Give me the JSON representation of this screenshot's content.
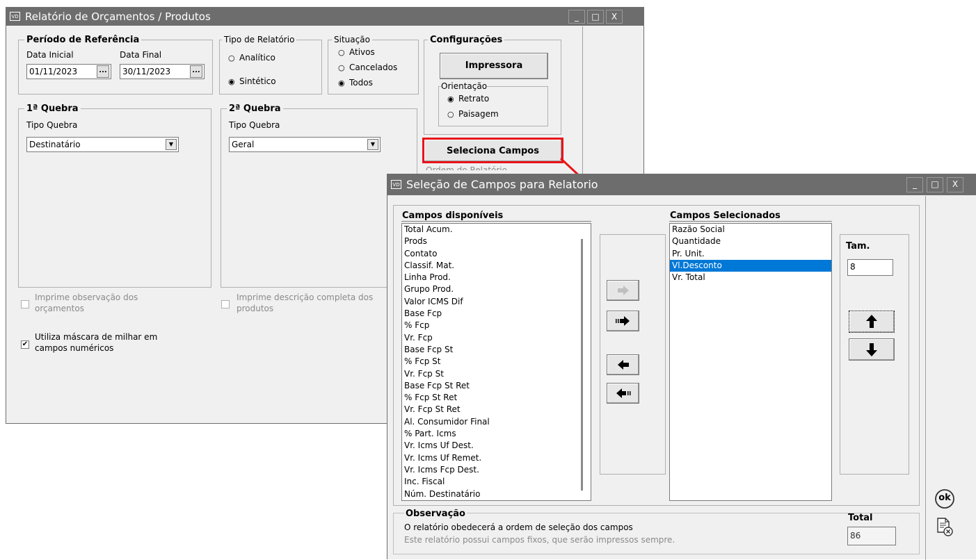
{
  "main_window": {
    "app_icon": "VD",
    "title": "Relatório de Orçamentos / Produtos",
    "title_buttons": [
      "_",
      "□",
      "X"
    ],
    "periodo": {
      "legend": "Período de Referência",
      "data_inicial_label": "Data Inicial",
      "data_inicial_value": "01/11/2023",
      "data_final_label": "Data Final",
      "data_final_value": "30/11/2023",
      "ellipsis": "..."
    },
    "tipo_relatorio": {
      "legend": "Tipo de Relatório",
      "options": [
        "Analítico",
        "Sintético"
      ],
      "selected": "Sintético"
    },
    "situacao": {
      "legend": "Situação",
      "options": [
        "Ativos",
        "Cancelados",
        "Todos"
      ],
      "selected": "Todos"
    },
    "configuracoes": {
      "legend": "Configurações",
      "impressora_label": "Impressora",
      "orientacao_legend": "Orientação",
      "orientacao_options": [
        "Retrato",
        "Paisagem"
      ],
      "orientacao_selected": "Retrato"
    },
    "seleciona_campos_label": "Seleciona Campos",
    "ordem_relatorio_label": "Ordem do Relatório",
    "quebra1": {
      "legend": "1ª Quebra",
      "tipo_label": "Tipo Quebra",
      "value": "Destinatário"
    },
    "quebra2": {
      "legend": "2ª Quebra",
      "tipo_label": "Tipo Quebra",
      "value": "Geral"
    },
    "imprime_observacao": {
      "label_line1": "Imprime observação dos",
      "label_line2": "orçamentos",
      "checked": false
    },
    "imprime_descricao": {
      "label_line1": "Imprime descrição completa dos",
      "label_line2": "produtos",
      "checked": false
    },
    "utiliza_mascara": {
      "label_line1": "Utiliza máscara de milhar em",
      "label_line2": "campos numéricos",
      "checked": true
    }
  },
  "dialog": {
    "app_icon": "VD",
    "title": "Seleção de Campos para Relatorio",
    "title_buttons": [
      "_",
      "□",
      "X"
    ],
    "available_header": "Campos disponíveis",
    "available": [
      "Total Acum.",
      "Prods",
      "Contato",
      "Classif. Mat.",
      "Linha Prod.",
      "Grupo Prod.",
      "Valor ICMS Dif",
      "Base Fcp",
      "% Fcp",
      "Vr. Fcp",
      "Base Fcp St",
      "% Fcp St",
      "Vr. Fcp St",
      "Base Fcp St Ret",
      "% Fcp St Ret",
      "Vr. Fcp St Ret",
      "Al. Consumidor Final",
      "% Part. Icms",
      "Vr. Icms Uf Dest.",
      "Vr. Icms Uf Remet.",
      "Vr. Icms Fcp Dest.",
      "Inc. Fiscal",
      "Núm. Destinatário"
    ],
    "selected_header": "Campos Selecionados",
    "selected": [
      "Razão Social",
      "Quantidade",
      "Pr. Unit.",
      "Vl.Desconto",
      "Vr. Total"
    ],
    "selected_highlight": "Vl.Desconto",
    "tam_label": "Tam.",
    "tam_value": "8",
    "observacao_legend": "Observação",
    "observacao_line1": "O relatório obedecerá a ordem de seleção dos campos",
    "observacao_line2": "Este relatório possui campos fixos, que serão impressos sempre.",
    "total_label": "Total",
    "total_value": "86"
  },
  "side_icons": {
    "ok_label": "ok"
  },
  "colors": {
    "titlebar": "#6d6d6d",
    "window_bg": "#f0f0f0",
    "selection": "#0078d7",
    "highlight_red": "#e8141b"
  }
}
